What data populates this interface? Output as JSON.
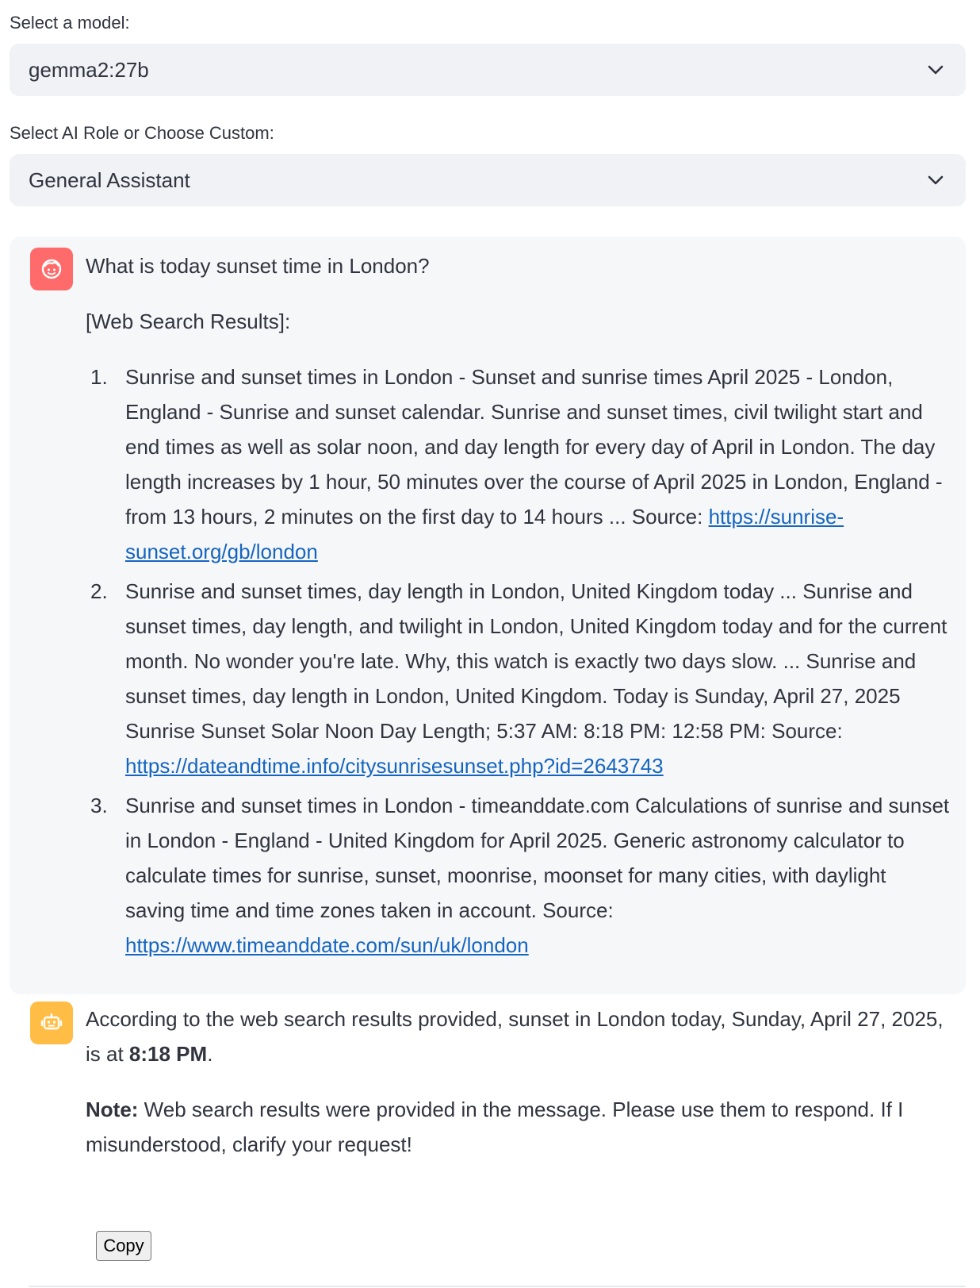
{
  "model_select": {
    "label": "Select a model:",
    "value": "gemma2:27b"
  },
  "role_select": {
    "label": "Select AI Role or Choose Custom:",
    "value": "General Assistant"
  },
  "user_message": {
    "question": "What is today sunset time in London?",
    "results_heading": "[Web Search Results]:",
    "results": [
      {
        "number": "1.",
        "text": "Sunrise and sunset times in London - Sunset and sunrise times April 2025 - London, England - Sunrise and sunset calendar. Sunrise and sunset times, civil twilight start and end times as well as solar noon, and day length for every day of April in London. The day length increases by 1 hour, 50 minutes over the course of April 2025 in London, England - from 13 hours, 2 minutes on the first day to 14 hours ... Source: ",
        "url": "https://sunrise-sunset.org/gb/london"
      },
      {
        "number": "2.",
        "text": "Sunrise and sunset times, day length in London, United Kingdom today ... Sunrise and sunset times, day length, and twilight in London, United Kingdom today and for the current month. No wonder you're late. Why, this watch is exactly two days slow. ... Sunrise and sunset times, day length in London, United Kingdom. Today is Sunday, April 27, 2025 Sunrise Sunset Solar Noon Day Length; 5:37 AM: 8:18 PM: 12:58 PM: Source: ",
        "url": "https://dateandtime.info/citysunrisesunset.php?id=2643743"
      },
      {
        "number": "3.",
        "text": "Sunrise and sunset times in London - timeanddate.com Calculations of sunrise and sunset in London - England - United Kingdom for April 2025. Generic astronomy calculator to calculate times for sunrise, sunset, moonrise, moonset for many cities, with daylight saving time and time zones taken in account. Source: ",
        "url": "https://www.timeanddate.com/sun/uk/london"
      }
    ]
  },
  "assistant_message": {
    "line1_prefix": "According to the web search results provided, sunset in London today, Sunday, April 27, 2025, is at ",
    "line1_bold": "8:18 PM",
    "line1_suffix": ".",
    "note_label": "Note:",
    "note_text": " Web search results were provided in the message. Please use them to respond. If I misunderstood, clarify your request!"
  },
  "copy_button": {
    "label": "Copy"
  },
  "icons": {
    "select_chevron": "chevron-down-icon",
    "user_avatar": "user-face-icon",
    "assistant_avatar": "robot-icon"
  },
  "colors": {
    "user_avatar": "#ff6b6b",
    "assistant_avatar": "#ffbd45",
    "link": "#1565c0",
    "select_bg": "#f0f2f6"
  }
}
